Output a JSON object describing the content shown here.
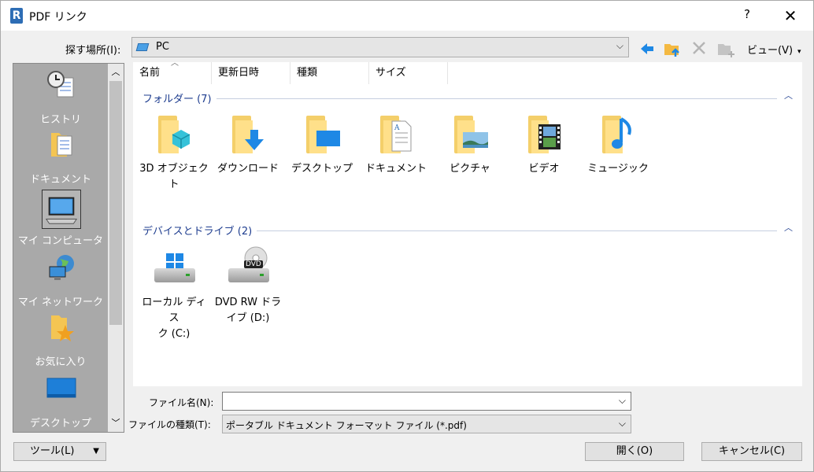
{
  "window": {
    "title": "PDF リンク",
    "app_icon_letter": "R",
    "help": "?",
    "close": "✕"
  },
  "toolbar": {
    "lookin_label": "探す場所(I):",
    "lookin_value": "PC",
    "view_label": "ビュー(V)"
  },
  "places": [
    {
      "name": "history",
      "label": "ヒストリ"
    },
    {
      "name": "documents",
      "label": "ドキュメント"
    },
    {
      "name": "my-computer",
      "label": "マイ コンピュータ"
    },
    {
      "name": "my-network",
      "label": "マイ ネットワーク"
    },
    {
      "name": "favorites",
      "label": "お気に入り"
    },
    {
      "name": "desktop",
      "label": "デスクトップ"
    }
  ],
  "columns": [
    "名前",
    "更新日時",
    "種類",
    "サイズ"
  ],
  "groups": {
    "folders": {
      "title": "フォルダー (7)",
      "items": [
        "3D オブジェクト",
        "ダウンロード",
        "デスクトップ",
        "ドキュメント",
        "ピクチャ",
        "ビデオ",
        "ミュージック"
      ]
    },
    "devices": {
      "title": "デバイスとドライブ (2)",
      "items": [
        {
          "line1": "ローカル ディス",
          "line2": "ク (C:)"
        },
        {
          "line1": "DVD RW ドラ",
          "line2": "イブ (D:)",
          "badge": "DVD"
        }
      ]
    }
  },
  "form": {
    "filename_label": "ファイル名(N):",
    "filename_value": "",
    "filetype_label": "ファイルの種類(T):",
    "filetype_value": "ポータブル ドキュメント フォーマット ファイル (*.pdf)"
  },
  "buttons": {
    "tools": "ツール(L)",
    "open": "開く(O)",
    "cancel": "キャンセル(C)"
  }
}
